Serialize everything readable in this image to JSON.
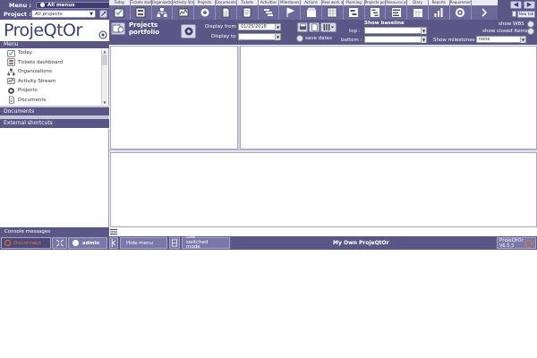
{
  "header": {
    "menu_label": "Menu :",
    "menu_value": "All menus",
    "project_label": "Project :",
    "project_value": "All projects"
  },
  "toolbar": {
    "items": [
      {
        "label": "Today",
        "icon": "today-icon"
      },
      {
        "label": "Tickets dashboard",
        "icon": "tickets-dashboard-icon"
      },
      {
        "label": "Organizations",
        "icon": "organizations-icon"
      },
      {
        "label": "Activity Stream",
        "icon": "activity-stream-icon"
      },
      {
        "label": "Projects",
        "icon": "projects-gear-icon"
      },
      {
        "label": "Documents",
        "icon": "documents-icon"
      },
      {
        "label": "Tickets",
        "icon": "tickets-icon"
      },
      {
        "label": "Activities",
        "icon": "activities-icon"
      },
      {
        "label": "Milestones",
        "icon": "milestones-flag-icon"
      },
      {
        "label": "Actions",
        "icon": "actions-icon"
      },
      {
        "label": "Real work allocation",
        "icon": "real-work-icon"
      },
      {
        "label": "Planning",
        "icon": "planning-icon"
      },
      {
        "label": "Projects portfolio",
        "icon": "projects-portfolio-icon"
      },
      {
        "label": "Resource planning",
        "icon": "resource-planning-icon"
      },
      {
        "label": "Diary",
        "icon": "diary-icon"
      },
      {
        "label": "Reports",
        "icon": "reports-icon"
      },
      {
        "label": "Requirements",
        "icon": "requirements-icon"
      },
      {
        "label": "",
        "icon": "more-icon"
      }
    ],
    "new_tab_label": "New tab"
  },
  "sidebar": {
    "logo_text": "ProjeQtOr",
    "menu_header": "Menu",
    "items": [
      {
        "label": "Today",
        "icon": "today-icon"
      },
      {
        "label": "Tickets dashboard",
        "icon": "tickets-dashboard-icon"
      },
      {
        "label": "Organizations",
        "icon": "organizations-icon"
      },
      {
        "label": "Activity Stream",
        "icon": "activity-stream-icon"
      },
      {
        "label": "Projects",
        "icon": "projects-gear-icon"
      },
      {
        "label": "Documents",
        "icon": "documents-icon"
      }
    ],
    "documents_header": "Documents",
    "shortcuts_header": "External shortcuts",
    "console_label": "Console messages"
  },
  "main": {
    "title_line1": "Projects",
    "title_line2": "portfolio",
    "display_from_label": "Display from",
    "display_from_value": "01/25/2018",
    "display_to_label": "Display to",
    "display_to_value": "",
    "save_dates_label": "save dates",
    "show_baseline_label": "Show baseline",
    "top_label": "top :",
    "bottom_label": "bottom :",
    "show_wbs_label": "show WBS",
    "show_closed_label": "show closed items",
    "show_milestones_label": "Show milestones",
    "show_milestones_value": "none"
  },
  "footer": {
    "disconnect_label": "Disconnect",
    "user_label": "admin",
    "hide_menu_label": "Hide menu",
    "switched_mode_label": "Use switched mode",
    "app_name": "My Own ProjeQtOr",
    "brand_name": "ProjeQtOr",
    "version": "V6.5.3"
  },
  "colors": {
    "chrome": "#5a5787",
    "chrome_dark": "#3f3d6e",
    "accent_orange": "#e8792b"
  }
}
